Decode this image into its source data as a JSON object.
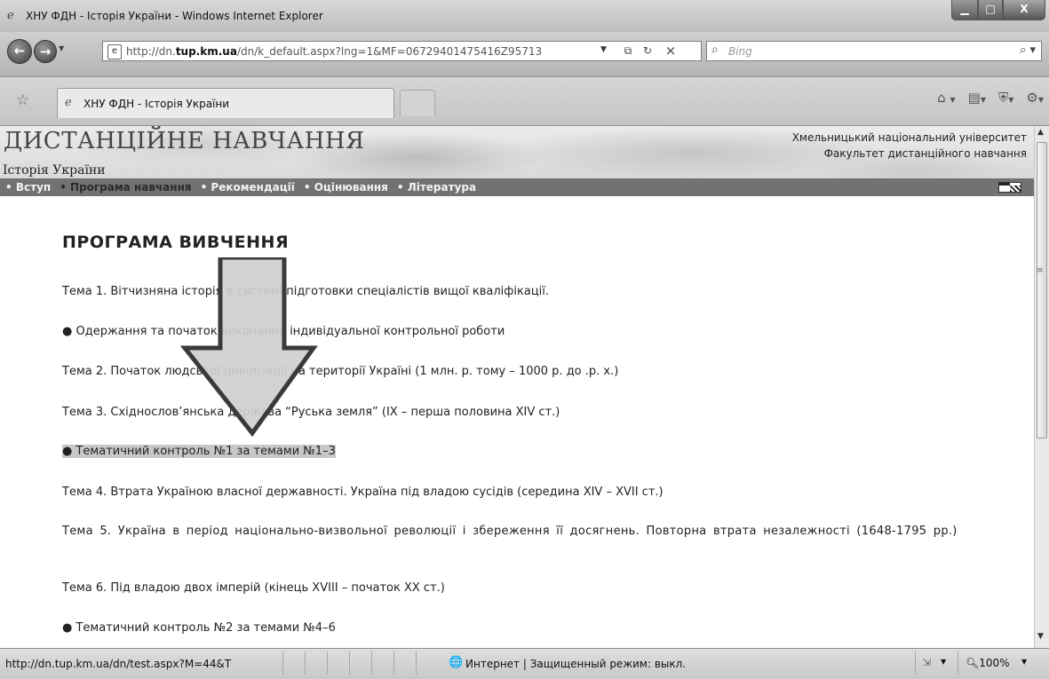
{
  "window": {
    "title": "ХНУ ФДН - Історія України - Windows Internet Explorer",
    "minimize": "▁",
    "maximize": "□",
    "close": "X"
  },
  "navbar": {
    "url_prefix": "http://dn.",
    "url_domain": "tup.km.ua",
    "url_suffix": "/dn/k_default.aspx?lng=1&MF=06729401475416Z95713",
    "search_placeholder": "Bing"
  },
  "tabs": {
    "active_title": "ХНУ ФДН - Історія України"
  },
  "site": {
    "title": "ДИСТАНЦІЙНЕ НАВЧАННЯ",
    "subtitle": "Історія України",
    "university": "Хмельницький національний університет",
    "faculty": "Факультет дистанційного навчання",
    "nav": [
      {
        "label": "• Вступ"
      },
      {
        "label": "• Програма навчання"
      },
      {
        "label": "• Рекомендації"
      },
      {
        "label": "• Оцінювання"
      },
      {
        "label": "• Література"
      }
    ]
  },
  "main": {
    "heading": "ПРОГРАМА ВИВЧЕННЯ",
    "items": [
      "Тема 1. Вітчизняна історія в системі підготовки спеціалістів вищої кваліфікації.",
      "● Одержання та початок виконання індивідуальної контрольної роботи",
      "Тема 2. Початок людської цивілізації на території Україні (1 млн. р. тому – 1000 р. до .р. х.)",
      "Тема 3. Східнослов’янська держава “Руська земля” (IX – перша половина XIV ст.)",
      "● Тематичний контроль №1 за темами №1–3",
      "Тема 4. Втрата Україною власної державності. Україна під владою сусідів (середина XIV – XVII ст.)",
      "Тема 5. Україна в період національно-визвольної революції і збереження її досягнень. Повторна втрата незалежності (1648-1795 рр.)",
      "Тема 6. Під владою двох імперій (кінець XVIII – початок XX ст.)",
      "● Тематичний контроль №2 за темами №4–6"
    ]
  },
  "statusbar": {
    "url": "http://dn.tup.km.ua/dn/test.aspx?M=44&T",
    "zone": "Интернет | Защищенный режим: выкл.",
    "zoom": "100%"
  }
}
